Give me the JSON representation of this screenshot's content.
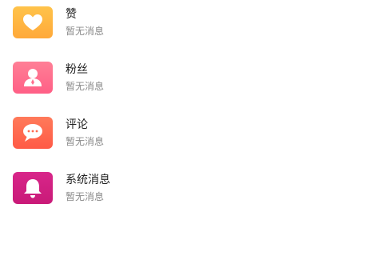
{
  "notifications": [
    {
      "title": "赞",
      "subtitle": "暂无消息",
      "icon": "heart-icon",
      "tile_color_top": "#ffc34a",
      "tile_color_bottom": "#ffa93a"
    },
    {
      "title": "粉丝",
      "subtitle": "暂无消息",
      "icon": "person-icon",
      "tile_color_top": "#ff7f96",
      "tile_color_bottom": "#ff5f86"
    },
    {
      "title": "评论",
      "subtitle": "暂无消息",
      "icon": "chat-bubble-icon",
      "tile_color_top": "#ff7a5a",
      "tile_color_bottom": "#ff5a46"
    },
    {
      "title": "系统消息",
      "subtitle": "暂无消息",
      "icon": "bell-icon",
      "tile_color_top": "#d8268a",
      "tile_color_bottom": "#c91a78"
    }
  ]
}
